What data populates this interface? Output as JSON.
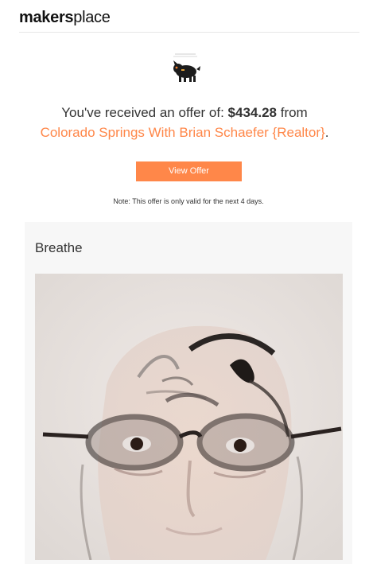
{
  "header": {
    "logo_bold": "makers",
    "logo_light": "place"
  },
  "offer": {
    "prefix": "You've received an offer of: ",
    "amount": "$434.28",
    "suffix": " from",
    "sender": "Colorado Springs With Brian Schaefer {Realtor}",
    "sender_period": ".",
    "button_label": "View Offer",
    "note": "Note: This offer is only valid for the next 4 days."
  },
  "artwork": {
    "title": "Breathe"
  },
  "colors": {
    "accent": "#ff8749",
    "card_bg": "#f7f7f7"
  }
}
